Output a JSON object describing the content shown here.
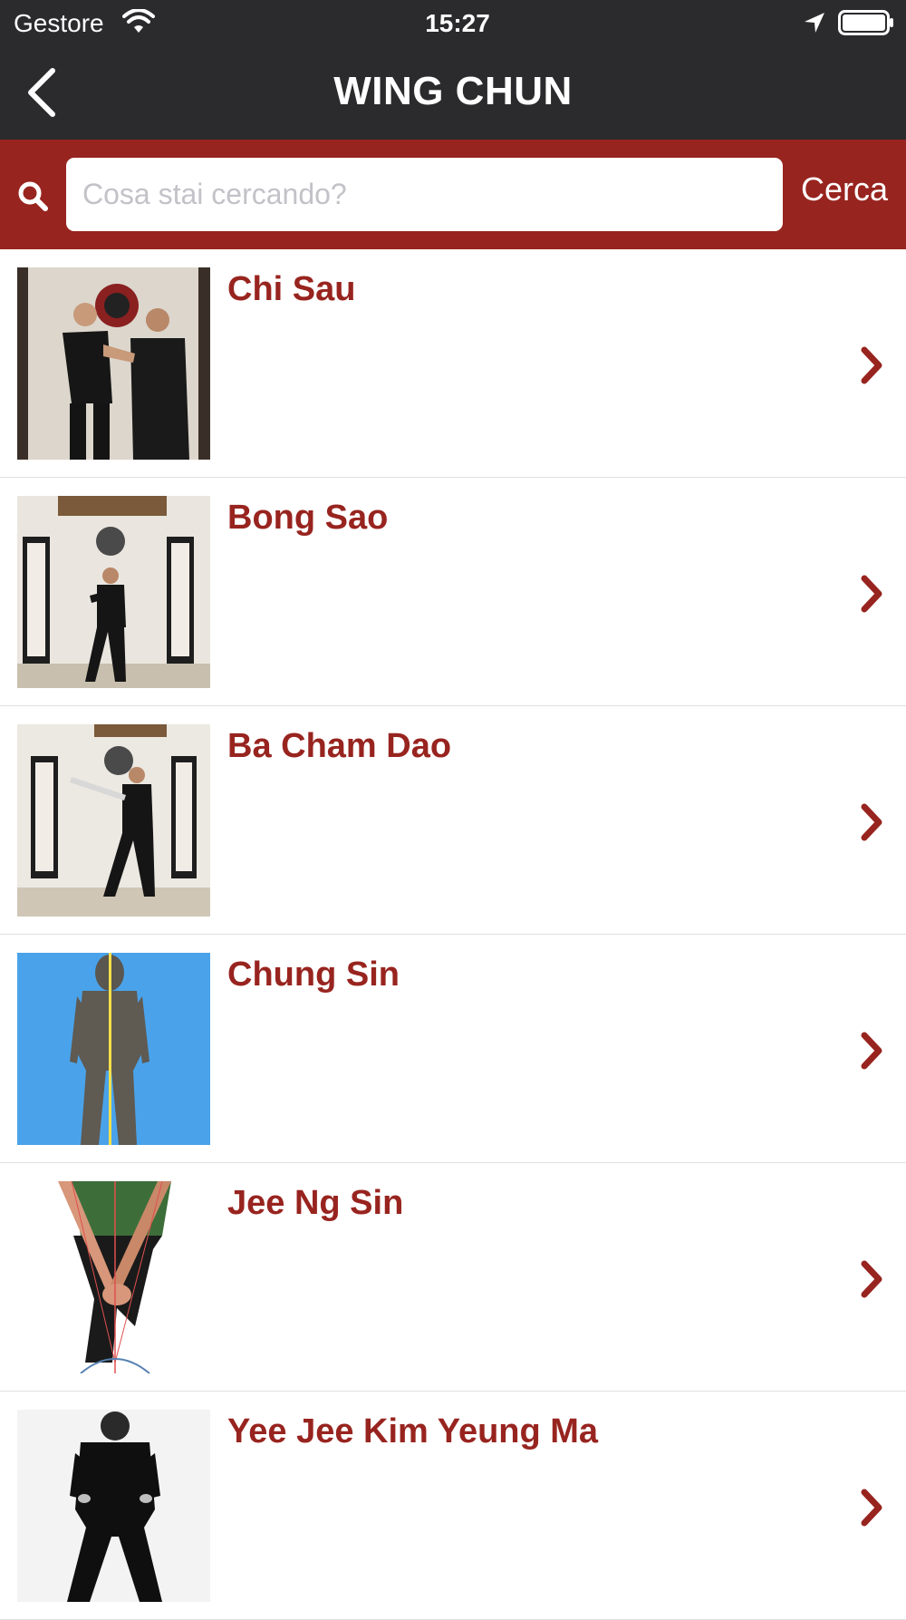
{
  "status_bar": {
    "carrier": "Gestore",
    "time": "15:27"
  },
  "nav": {
    "title": "WING CHUN",
    "back_icon": "chevron-left-icon"
  },
  "search": {
    "placeholder": "Cosa stai cercando?",
    "value": "",
    "button_label": "Cerca"
  },
  "colors": {
    "bar_dark": "#2b2b2d",
    "accent_red": "#98241f",
    "placeholder": "#c2c2c8",
    "divider": "#e0e0e0"
  },
  "items": [
    {
      "title": "Chi Sau",
      "image": "photo-two-men-chi-sau"
    },
    {
      "title": "Bong Sao",
      "image": "photo-man-bong-sao-stance"
    },
    {
      "title": "Ba Cham Dao",
      "image": "photo-man-with-butterfly-swords"
    },
    {
      "title": "Chung Sin",
      "image": "photo-figure-centerline-blue"
    },
    {
      "title": "Jee Ng Sin",
      "image": "photo-arms-centerline-diagram"
    },
    {
      "title": "Yee Jee Kim Yeung Ma",
      "image": "photo-man-stance-black-white"
    }
  ]
}
